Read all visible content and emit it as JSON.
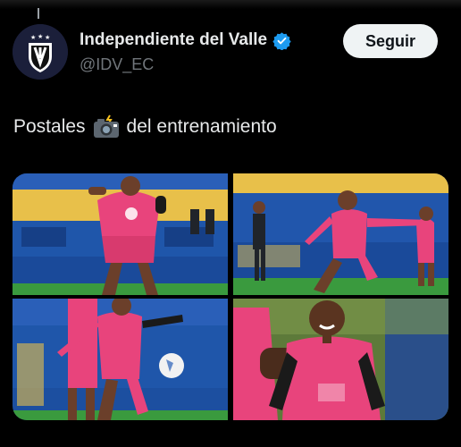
{
  "tweet": {
    "author": {
      "display_name": "Independiente del Valle",
      "handle": "@IDV_EC",
      "verified": true
    },
    "follow_label": "Seguir",
    "text_before": "Postales",
    "text_emoji": "camera-with-flash-emoji",
    "text_after": "del entrenamiento",
    "media": [
      {
        "kind": "photo",
        "subject": "player-control-ball"
      },
      {
        "kind": "photo",
        "subject": "player-kick"
      },
      {
        "kind": "photo",
        "subject": "player-dribble-ball"
      },
      {
        "kind": "photo",
        "subject": "player-smiling"
      }
    ]
  },
  "colors": {
    "background": "#000000",
    "text": "#e7e9ea",
    "secondary_text": "#71767b",
    "verified": "#1d9bf0",
    "button_bg": "#eff3f4",
    "kit_pink": "#e8447c"
  }
}
